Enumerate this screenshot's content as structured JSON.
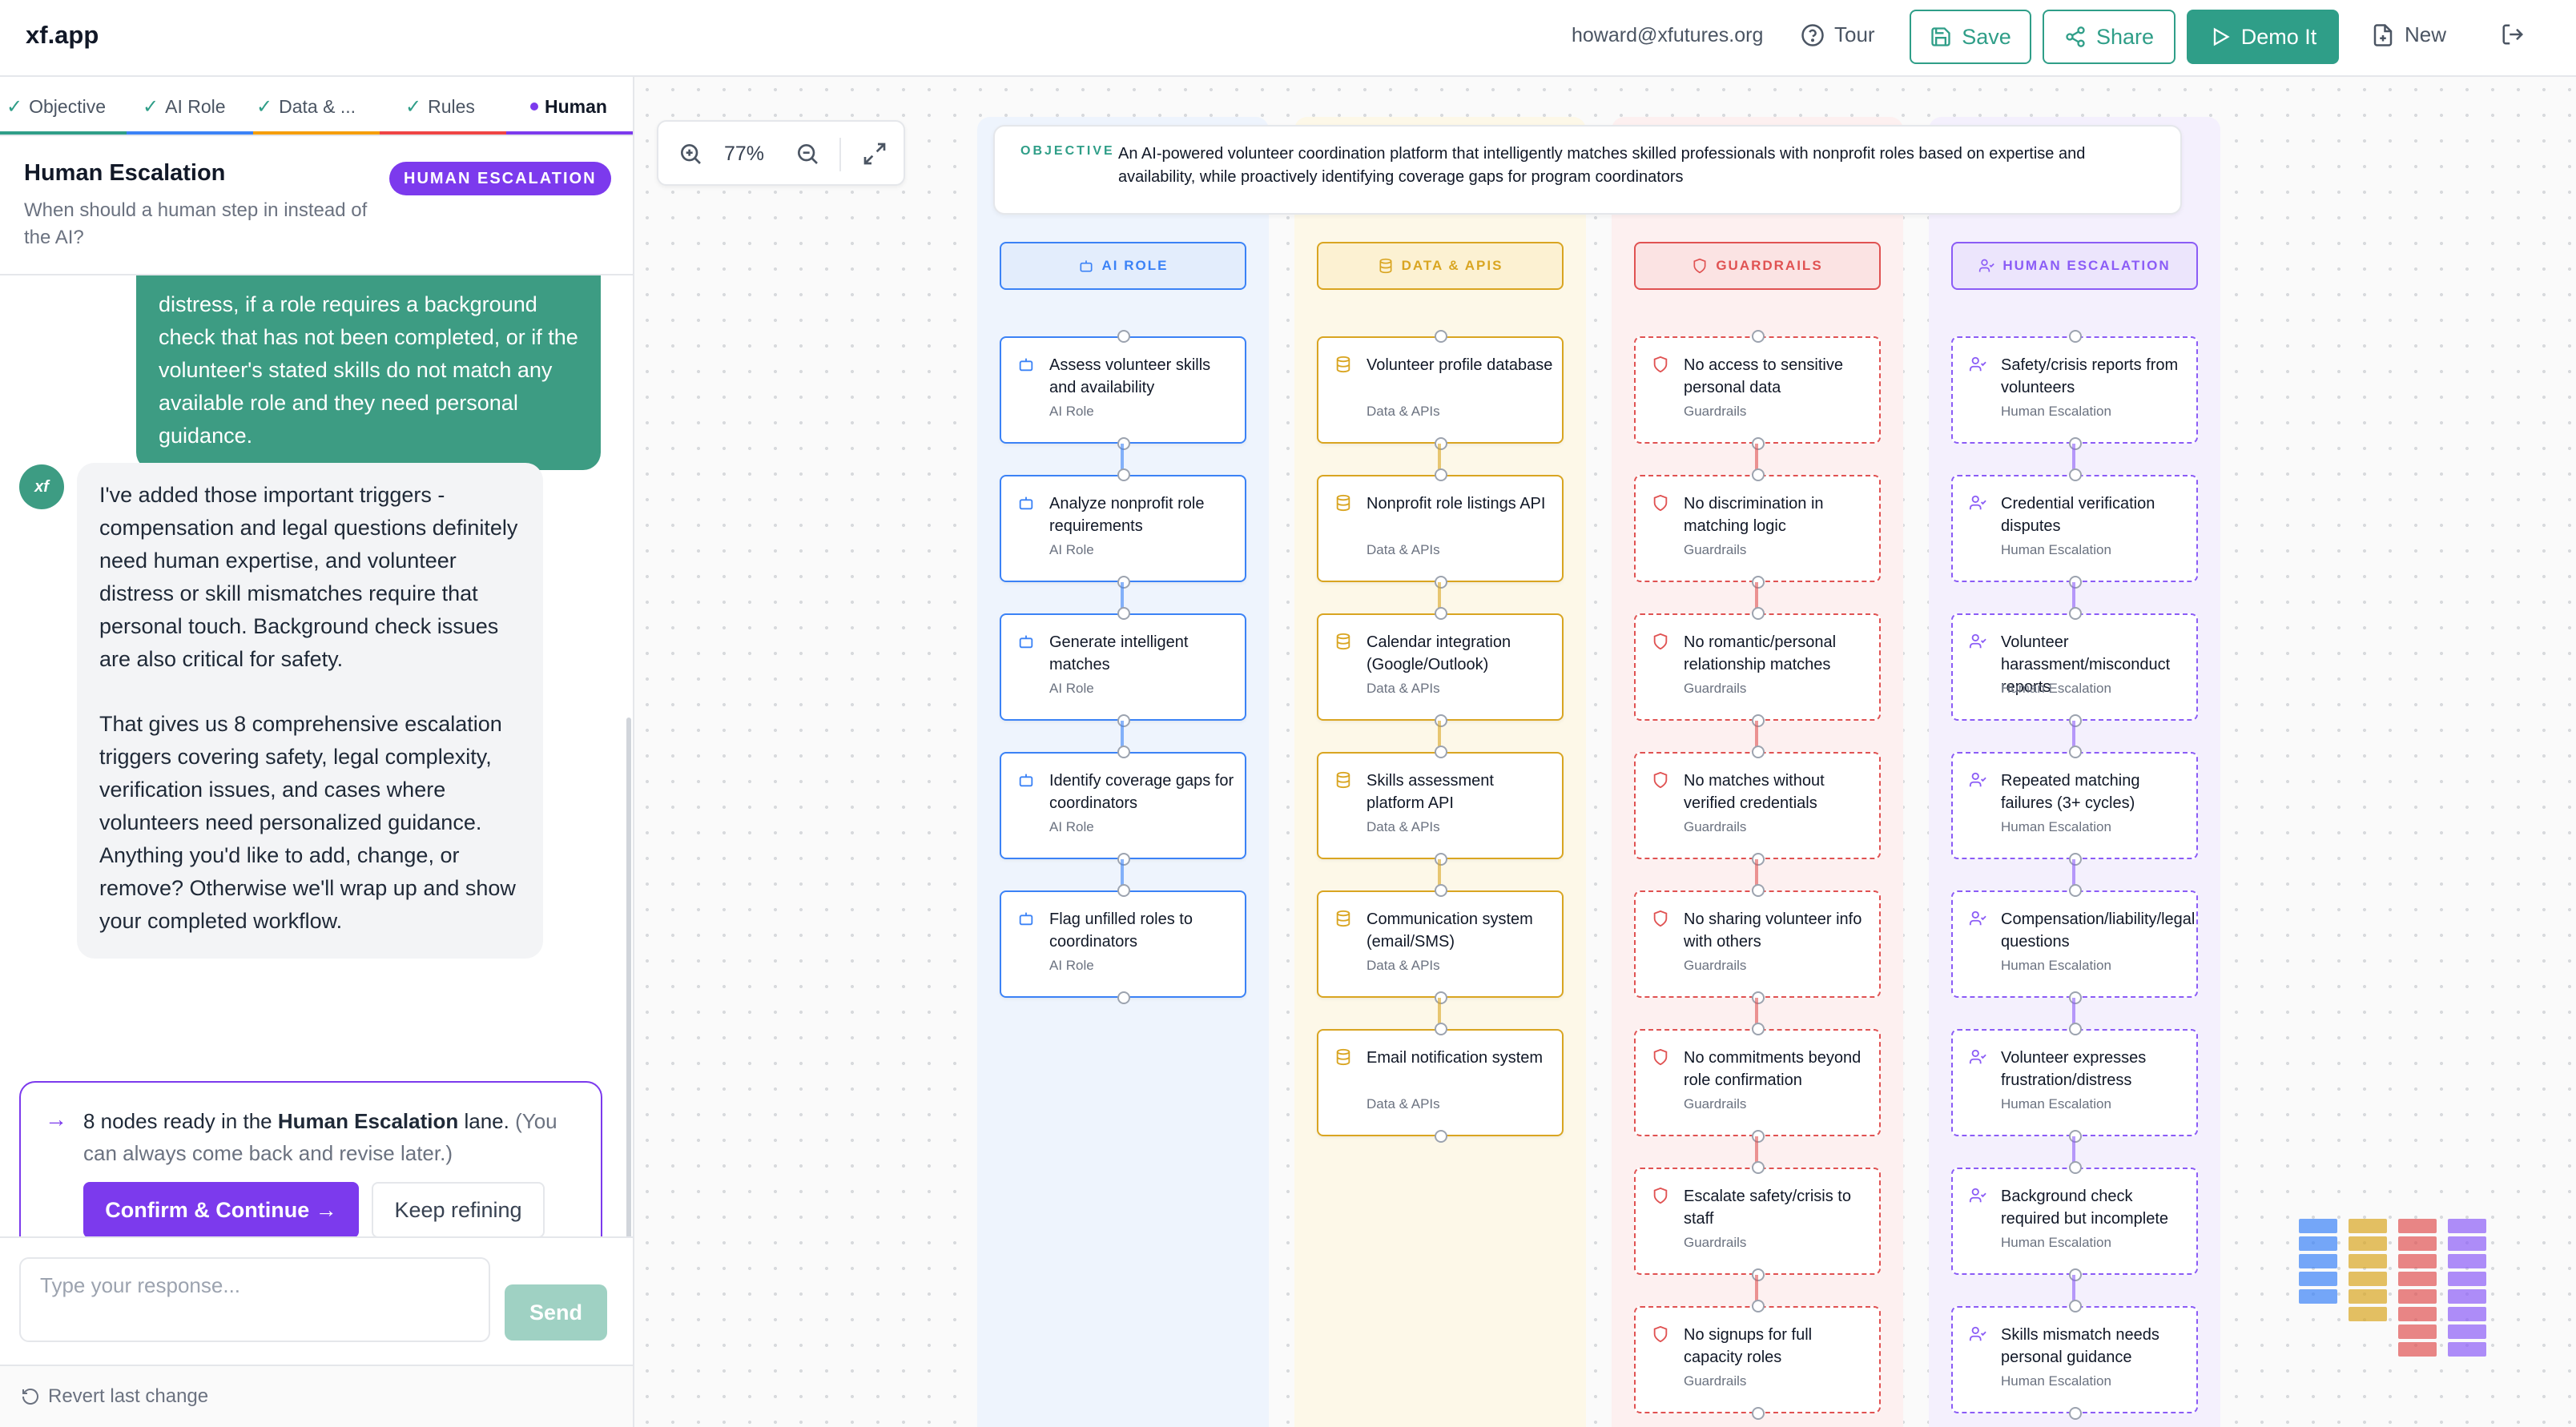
{
  "app": {
    "title": "xf.app",
    "user_email": "howard@xfutures.org"
  },
  "header": {
    "tour": "Tour",
    "save": "Save",
    "share": "Share",
    "demo": "Demo It",
    "new": "New",
    "accent": "#2f9e88"
  },
  "tabs": [
    {
      "label": "Objective",
      "done": true,
      "color": "#2f9e88"
    },
    {
      "label": "AI Role",
      "done": true,
      "color": "#3b82f6"
    },
    {
      "label": "Data & ...",
      "done": true,
      "color": "#f59e0b"
    },
    {
      "label": "Rules",
      "done": true,
      "color": "#ef4444"
    },
    {
      "label": "Human",
      "done": false,
      "active": true,
      "color": "#7c3aed"
    }
  ],
  "panel": {
    "title": "Human Escalation",
    "subtitle": "When should a human step in instead of the AI?",
    "badge": "HUMAN ESCALATION"
  },
  "chat": {
    "user_message": "distress, if a role requires a background check that has not been completed, or if the volunteer's stated skills do not match any available role and they need personal guidance.",
    "assistant_avatar": "xf",
    "assistant_p1": "I've added those important triggers - compensation and legal questions definitely need human expertise, and volunteer distress or skill mismatches require that personal touch. Background check issues are also critical for safety.",
    "assistant_p2": "That gives us 8 comprehensive escalation triggers covering safety, legal complexity, verification issues, and cases where volunteers need personalized guidance. Anything you'd like to add, change, or remove? Otherwise we'll wrap up and show your completed workflow.",
    "ready_prefix": "8 nodes ready in the ",
    "ready_lane": "Human Escalation",
    "ready_suffix": " lane.",
    "ready_note": " (You can always come back and revise later.)",
    "confirm": "Confirm & Continue →",
    "refine": "Keep refining"
  },
  "input": {
    "placeholder": "Type your response...",
    "send": "Send"
  },
  "revert": "Revert last change",
  "zoom": {
    "level": "77%"
  },
  "objective": {
    "label": "OBJECTIVE",
    "text": "An AI-powered volunteer coordination platform that intelligently matches skilled professionals with nonprofit roles based on expertise and availability, while proactively identifying coverage gaps for program coordinators"
  },
  "lanes": [
    {
      "key": "ai",
      "header": "AI ROLE",
      "color": "#3b82f6",
      "bg": "#eef4fd",
      "hbg": "#e3edfc",
      "icon": "robot-icon",
      "dashed": false,
      "nodes": [
        {
          "title": "Assess volunteer skills and availability",
          "cat": "AI Role"
        },
        {
          "title": "Analyze nonprofit role requirements",
          "cat": "AI Role"
        },
        {
          "title": "Generate intelligent matches",
          "cat": "AI Role"
        },
        {
          "title": "Identify coverage gaps for coordinators",
          "cat": "AI Role"
        },
        {
          "title": "Flag unfilled roles to coordinators",
          "cat": "AI Role"
        }
      ]
    },
    {
      "key": "data",
      "header": "DATA & APIS",
      "color": "#d9a521",
      "bg": "#fdf8e8",
      "hbg": "#fcf1d2",
      "icon": "database-icon",
      "dashed": false,
      "nodes": [
        {
          "title": "Volunteer profile database",
          "cat": "Data & APIs"
        },
        {
          "title": "Nonprofit role listings API",
          "cat": "Data & APIs"
        },
        {
          "title": "Calendar integration (Google/Outlook)",
          "cat": "Data & APIs"
        },
        {
          "title": "Skills assessment platform API",
          "cat": "Data & APIs"
        },
        {
          "title": "Communication system (email/SMS)",
          "cat": "Data & APIs"
        },
        {
          "title": "Email notification system",
          "cat": "Data & APIs"
        }
      ]
    },
    {
      "key": "rules",
      "header": "GUARDRAILS",
      "color": "#e05252",
      "bg": "#fdf0f0",
      "hbg": "#fbe3e3",
      "icon": "shield-icon",
      "dashed": true,
      "nodes": [
        {
          "title": "No access to sensitive personal data",
          "cat": "Guardrails"
        },
        {
          "title": "No discrimination in matching logic",
          "cat": "Guardrails"
        },
        {
          "title": "No romantic/personal relationship matches",
          "cat": "Guardrails"
        },
        {
          "title": "No matches without verified credentials",
          "cat": "Guardrails"
        },
        {
          "title": "No sharing volunteer info with others",
          "cat": "Guardrails"
        },
        {
          "title": "No commitments beyond role confirmation",
          "cat": "Guardrails"
        },
        {
          "title": "Escalate safety/crisis to staff",
          "cat": "Guardrails"
        },
        {
          "title": "No signups for full capacity roles",
          "cat": "Guardrails"
        }
      ]
    },
    {
      "key": "human",
      "header": "HUMAN ESCALATION",
      "color": "#8b5cf6",
      "bg": "#f4f0fd",
      "hbg": "#ece5fc",
      "icon": "user-icon",
      "dashed": true,
      "nodes": [
        {
          "title": "Safety/crisis reports from volunteers",
          "cat": "Human Escalation"
        },
        {
          "title": "Credential verification disputes",
          "cat": "Human Escalation"
        },
        {
          "title": "Volunteer harassment/misconduct reports",
          "cat": "Human Escalation"
        },
        {
          "title": "Repeated matching failures (3+ cycles)",
          "cat": "Human Escalation"
        },
        {
          "title": "Compensation/liability/legal questions",
          "cat": "Human Escalation"
        },
        {
          "title": "Volunteer expresses frustration/distress",
          "cat": "Human Escalation"
        },
        {
          "title": "Background check required but incomplete",
          "cat": "Human Escalation"
        },
        {
          "title": "Skills mismatch needs personal guidance",
          "cat": "Human Escalation"
        }
      ]
    }
  ]
}
